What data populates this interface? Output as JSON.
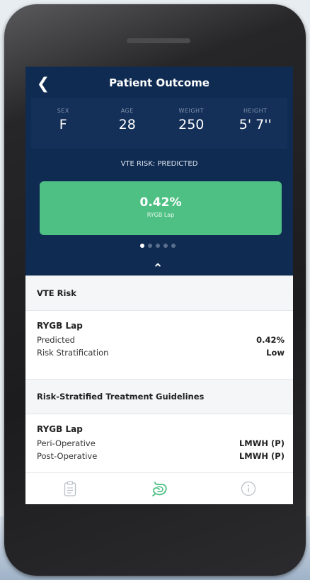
{
  "header": {
    "title": "Patient Outcome",
    "back_icon": "chevron-left-icon"
  },
  "stats": [
    {
      "label": "SEX",
      "value": "F"
    },
    {
      "label": "AGE",
      "value": "28"
    },
    {
      "label": "WEIGHT",
      "value": "250"
    },
    {
      "label": "HEIGHT",
      "value": "5' 7''"
    }
  ],
  "vte_label": "VTE RISK: PREDICTED",
  "card": {
    "percent": "0.42%",
    "procedure": "RYGB Lap",
    "color": "#4fc084"
  },
  "carousel": {
    "dot_count": 5,
    "active_index": 0
  },
  "vte_section": {
    "heading": "VTE Risk",
    "procedure": "RYGB Lap",
    "rows": [
      {
        "label": "Predicted",
        "value": "0.42%"
      },
      {
        "label": "Risk Stratification",
        "value": "Low"
      }
    ]
  },
  "guidelines_section": {
    "heading": "Risk-Stratified Treatment Guidelines",
    "procedure": "RYGB Lap",
    "rows": [
      {
        "label": "Peri-Operative",
        "value": "LMWH (P)"
      },
      {
        "label": "Post-Operative",
        "value": "LMWH (P)"
      }
    ]
  },
  "tabbar": {
    "tabs": [
      "clipboard-icon",
      "stomach-icon",
      "info-icon"
    ],
    "active": 1
  },
  "colors": {
    "navy": "#0f2b52",
    "green": "#4fc084"
  }
}
